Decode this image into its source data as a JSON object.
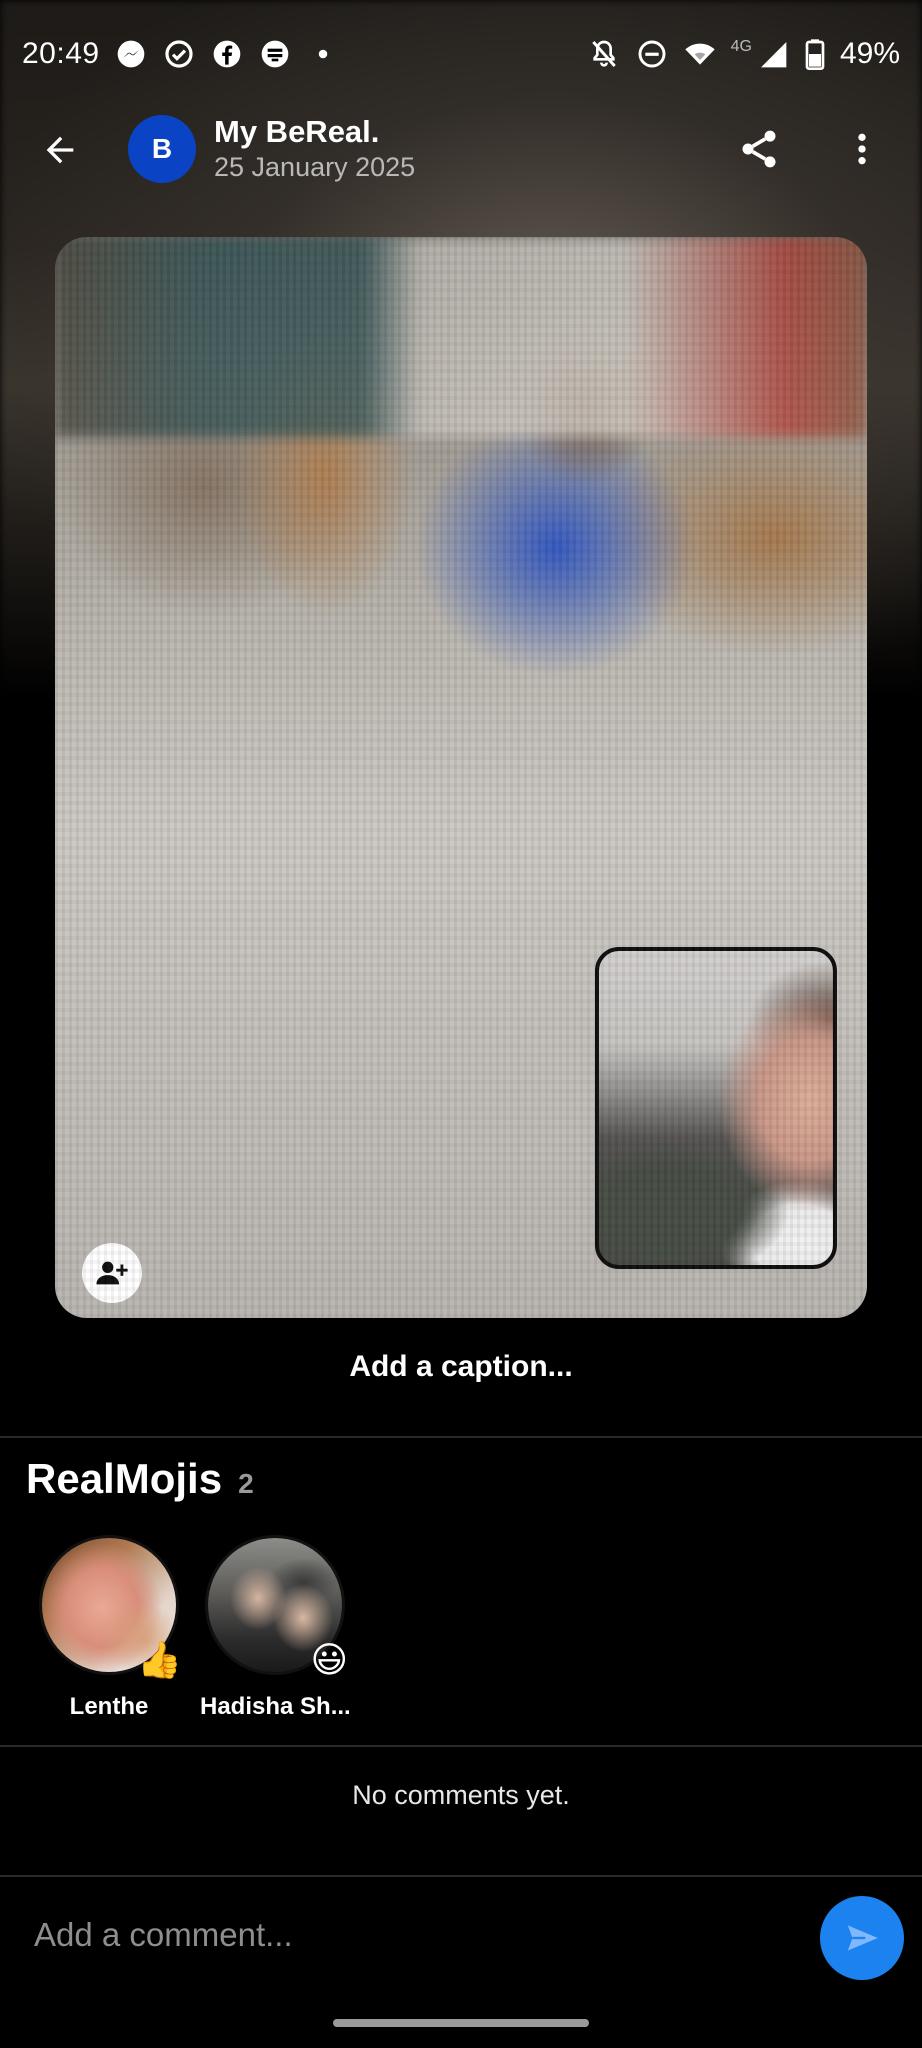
{
  "status_bar": {
    "time": "20:49",
    "network": "4G",
    "battery": "49%",
    "left_icons": [
      "messenger-icon",
      "check-circle-icon",
      "facebook-icon",
      "app-notification-icon",
      "dot-icon"
    ],
    "right_icons": [
      "bell-off-icon",
      "do-not-disturb-icon",
      "wifi-icon",
      "signal-icon",
      "battery-icon"
    ]
  },
  "header": {
    "avatar_initial": "B",
    "avatar_color": "#0a44c4",
    "title": "My BeReal.",
    "date": "25 January 2025"
  },
  "post": {
    "caption_prompt": "Add a caption..."
  },
  "realmojis": {
    "title": "RealMojis",
    "count": "2",
    "items": [
      {
        "name": "Lenthe",
        "emoji": "👍"
      },
      {
        "name": "Hadisha Sh...",
        "emoji": "😃"
      }
    ]
  },
  "comments": {
    "empty_text": "No comments yet.",
    "input_placeholder": "Add a comment...",
    "send_color": "#1b82f0"
  }
}
